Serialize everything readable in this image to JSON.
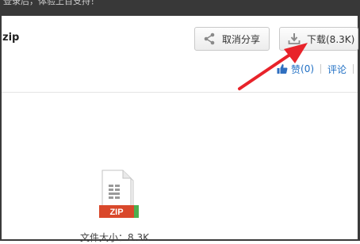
{
  "topbar": {
    "text": "登录后，体验上百支持！"
  },
  "file": {
    "title_suffix": "zip",
    "size_text": "文件大小：8.3K",
    "badge": "ZIP"
  },
  "buttons": {
    "cancel_share": "取消分享",
    "download": "下载(8.3K)"
  },
  "social": {
    "like_label": "赞",
    "like_count": "(0)",
    "comment_label": "评论"
  },
  "colors": {
    "arrow": "#e8232a",
    "link": "#1f6fc4",
    "zip_badge": "#d9482b"
  }
}
